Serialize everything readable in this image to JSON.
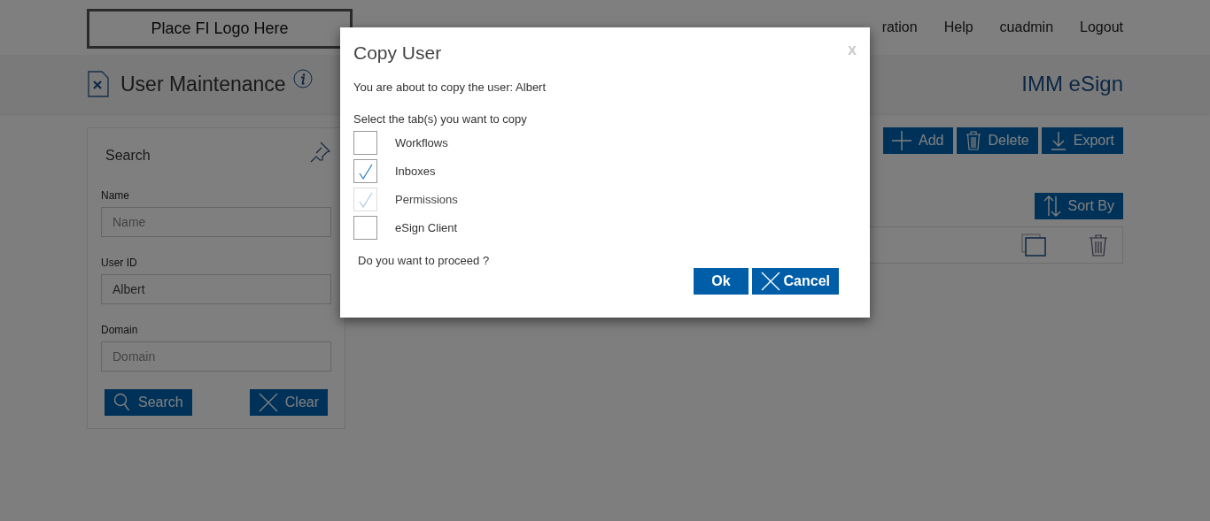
{
  "header": {
    "logo": "Place FI Logo Here",
    "nav": [
      "ration",
      "Help",
      "cuadmin",
      "Logout"
    ]
  },
  "page": {
    "title": "User Maintenance",
    "app_name": "IMM eSign"
  },
  "search_panel": {
    "title": "Search",
    "fields": [
      {
        "label": "Name",
        "placeholder": "Name"
      },
      {
        "label": "User ID",
        "value": "Albert"
      },
      {
        "label": "Domain",
        "placeholder": "Domain"
      }
    ],
    "buttons": [
      {
        "label": "Search",
        "kind": "search"
      },
      {
        "label": "Clear",
        "kind": "clear"
      }
    ]
  },
  "toolbar": [
    {
      "label": "Add",
      "kind": "add"
    },
    {
      "label": "Delete",
      "kind": "delete"
    },
    {
      "label": "Export",
      "kind": "export"
    }
  ],
  "sort_button": "Sort By",
  "dialog": {
    "title": "Copy User",
    "close": "x",
    "message": "You are about to copy the user: Albert",
    "prompt": "Select the tab(s) you want to copy",
    "options": [
      {
        "label": "Workflows",
        "checked": false,
        "disabled": false
      },
      {
        "label": "Inboxes",
        "checked": true,
        "disabled": false
      },
      {
        "label": "Permissions",
        "checked": true,
        "disabled": true
      },
      {
        "label": "eSign Client",
        "checked": false,
        "disabled": false
      }
    ],
    "question": "Do you want to proceed ?",
    "buttons": [
      {
        "label": "Ok",
        "kind": "ok"
      },
      {
        "label": "Cancel",
        "kind": "cancel"
      }
    ]
  }
}
